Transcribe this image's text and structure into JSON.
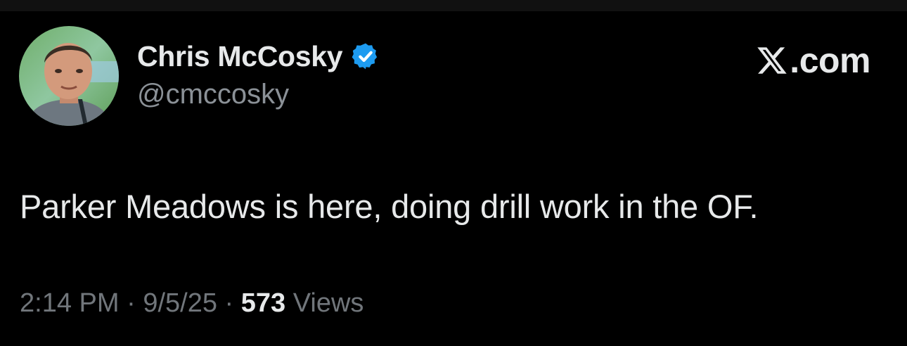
{
  "author": {
    "display_name": "Chris McCosky",
    "handle": "@cmccosky",
    "verified": true,
    "verified_color": "#1d9bf0"
  },
  "branding": {
    "site_label": ".com",
    "logo_icon": "x-logo-icon"
  },
  "tweet": {
    "text": "Parker Meadows is here, doing drill work in the OF."
  },
  "meta": {
    "time": "2:14 PM",
    "separator": " · ",
    "date": "9/5/25",
    "views_count": "573",
    "views_label": " Views"
  },
  "colors": {
    "background": "#000000",
    "primary_text": "#e7e9ea",
    "secondary_text": "#71767b"
  }
}
